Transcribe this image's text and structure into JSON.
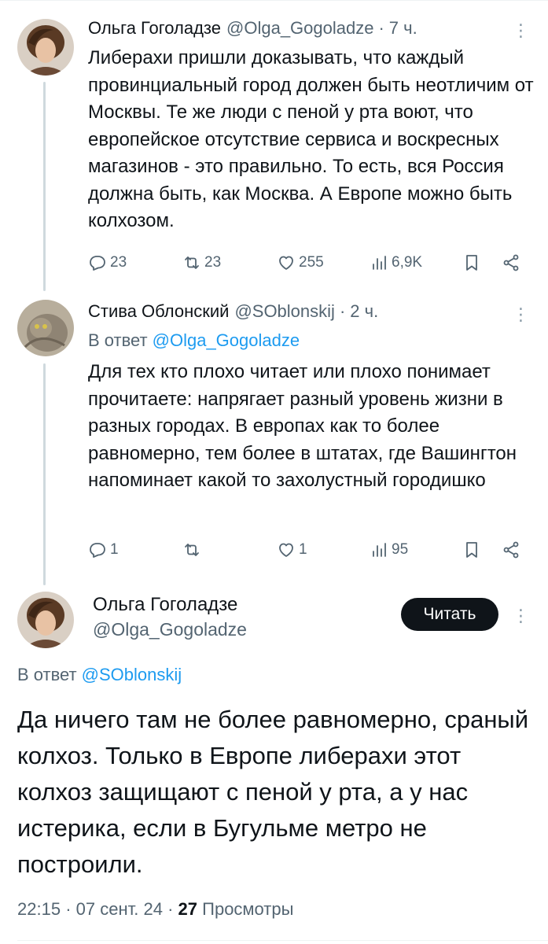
{
  "tweets": [
    {
      "author_name": "Ольга Гоголадзе",
      "handle": "@Olga_Gogoladze",
      "dot": "·",
      "time": "7 ч.",
      "more": "⋮",
      "text": "Либерахи пришли доказывать, что каждый провинциальный город должен быть неотличим от Москвы. Те же люди с пеной у рта воют, что европейское отсутствие сервиса и воскресных магазинов - это правильно. То есть, вся Россия должна быть, как Москва. А Европе можно быть колхозом.",
      "replies": "23",
      "retweets": "23",
      "likes": "255",
      "views": "6,9K"
    },
    {
      "author_name": "Стива Облонский",
      "handle": "@SOblonskij",
      "dot": "·",
      "time": "2 ч.",
      "more": "⋮",
      "reply_prefix": "В ответ",
      "reply_to": "@Olga_Gogoladze",
      "text": "Для тех кто плохо читает или плохо понимает прочитаете: напрягает разный уровень жизни в разных городах. В европах как то более равномерно, тем более в штатах, где Вашингтон напоминает какой то захолустный городишко",
      "replies": "1",
      "retweets": "",
      "likes": "1",
      "views": "95"
    }
  ],
  "main": {
    "author_name": "Ольга Гоголадзе",
    "handle": "@Olga_Gogoladze",
    "follow_label": "Читать",
    "more": "⋮",
    "reply_prefix": "В ответ",
    "reply_to": "@SOblonskij",
    "text": "Да ничего там не более равномерно, сраный колхоз. Только в Европе либерахи этот колхоз защищают с пеной у рта, а у нас истерика, если в Бугульме метро не построили.",
    "time": "22:15",
    "sep": "·",
    "date": "07 сент. 24",
    "views_count": "27",
    "views_label": "Просмотры"
  },
  "icons": [
    "reply-icon",
    "retweet-icon",
    "like-icon",
    "views-icon",
    "bookmark-icon",
    "share-icon",
    "more-icon"
  ],
  "colors": {
    "text": "#0f1419",
    "secondary": "#536471",
    "link": "#1d9bf0",
    "thread_line": "#cfd9de",
    "button": "#0f1419"
  }
}
